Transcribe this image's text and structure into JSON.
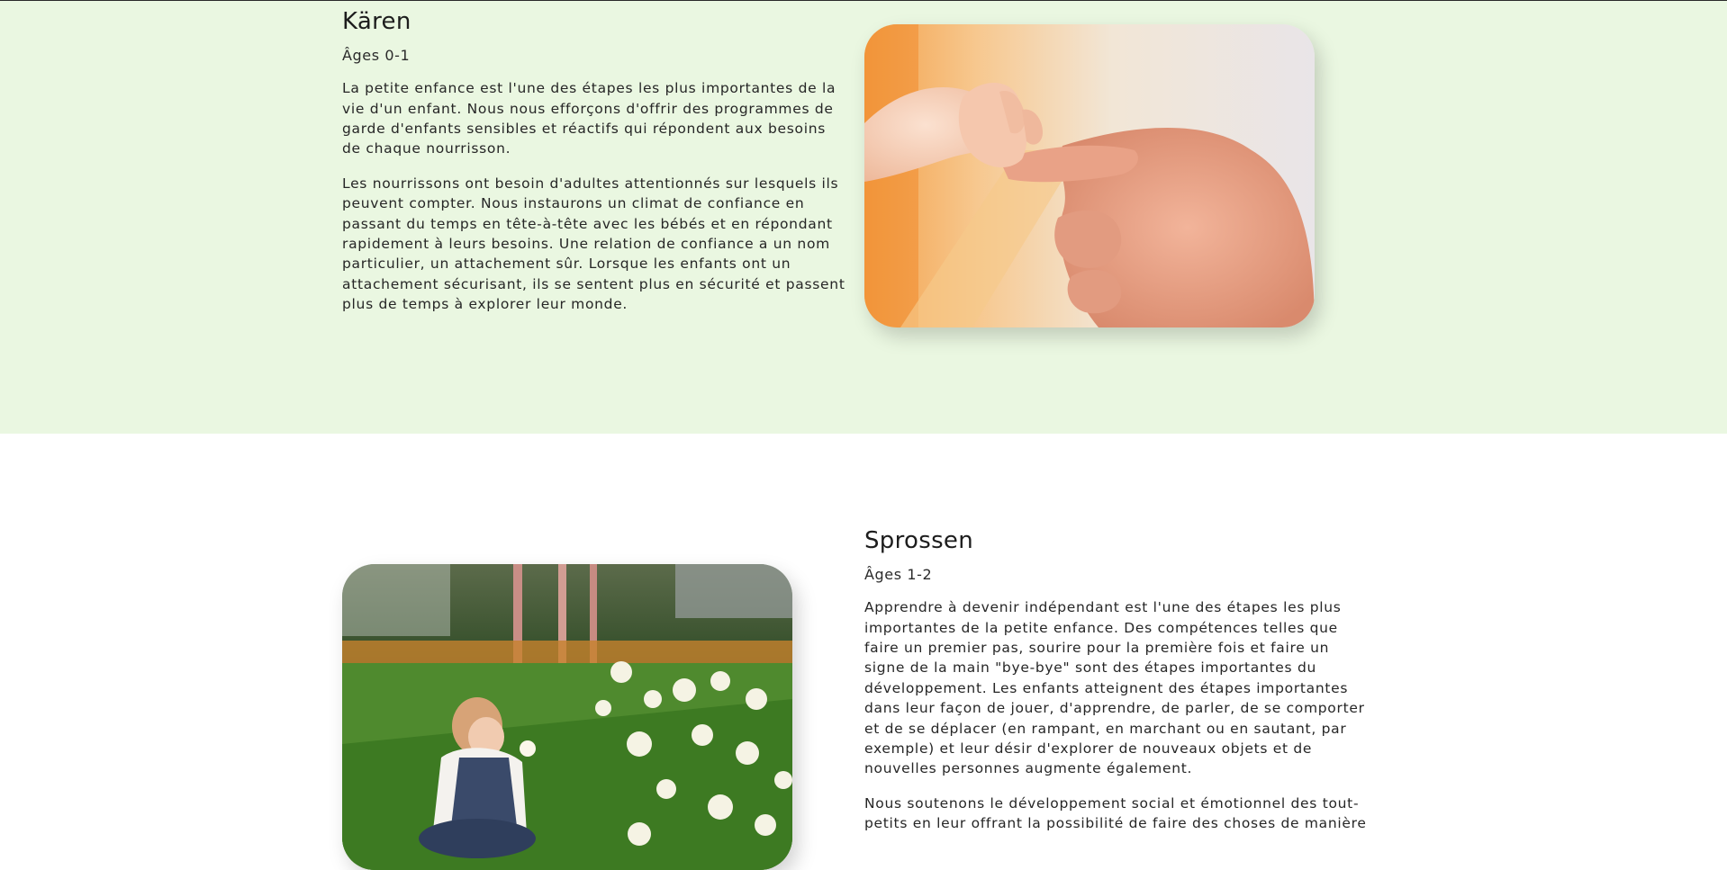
{
  "infants": {
    "title": "Kären",
    "ages": "Âges 0-1",
    "paragraphs": [
      "La petite enfance est l'une des étapes les plus importantes de la vie d'un enfant. Nous nous efforçons d'offrir des programmes de garde d'enfants sensibles et réactifs qui répondent aux besoins de chaque nourrisson.",
      "Les nourrissons ont besoin d'adultes attentionnés sur lesquels ils peuvent compter. Nous instaurons un climat de confiance en passant du temps en tête-à-tête avec les bébés et en répondant rapidement à leurs besoins. Une relation de confiance a un nom particulier, un attachement sûr. Lorsque les enfants ont un attachement sécurisant, ils se sentent plus en sécurité et passent plus de temps à explorer leur monde."
    ],
    "image": "baby-holding-adult-finger-photo"
  },
  "toddlers": {
    "title": "Sprossen",
    "ages": "Âges 1-2",
    "paragraphs": [
      "Apprendre à devenir indépendant est l'une des étapes les plus importantes de la petite enfance. Des compétences telles que faire un premier pas, sourire pour la première fois et faire un signe de la main \"bye-bye\" sont des étapes importantes du développement. Les enfants atteignent des étapes importantes dans leur façon de jouer, d'apprendre, de parler, de se comporter et de se déplacer (en rampant, en marchant ou en sautant, par exemple) et leur désir d'explorer de nouveaux objets et de nouvelles personnes augmente également.",
      "Nous soutenons le développement social et émotionnel des tout-petits en leur offrant la possibilité de faire des choses de manière"
    ],
    "image": "toddler-smelling-daffodils-photo"
  }
}
